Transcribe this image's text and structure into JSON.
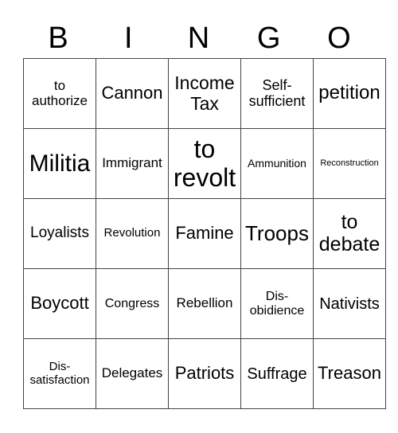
{
  "header": [
    "B",
    "I",
    "N",
    "G",
    "O"
  ],
  "cells": [
    [
      {
        "text": "to authorize",
        "size": 17
      },
      {
        "text": "Cannon",
        "size": 22
      },
      {
        "text": "Income Tax",
        "size": 23
      },
      {
        "text": "Self-sufficient",
        "size": 18
      },
      {
        "text": "petition",
        "size": 24
      }
    ],
    [
      {
        "text": "Militia",
        "size": 30
      },
      {
        "text": "Immigrant",
        "size": 17
      },
      {
        "text": "to revolt",
        "size": 32
      },
      {
        "text": "Ammunition",
        "size": 14
      },
      {
        "text": "Reconstruction",
        "size": 11
      }
    ],
    [
      {
        "text": "Loyalists",
        "size": 19
      },
      {
        "text": "Revolution",
        "size": 15
      },
      {
        "text": "Famine",
        "size": 22
      },
      {
        "text": "Troops",
        "size": 26
      },
      {
        "text": "to debate",
        "size": 25
      }
    ],
    [
      {
        "text": "Boycott",
        "size": 22
      },
      {
        "text": "Congress",
        "size": 16
      },
      {
        "text": "Rebellion",
        "size": 17
      },
      {
        "text": "Dis-obidience",
        "size": 16
      },
      {
        "text": "Nativists",
        "size": 20
      }
    ],
    [
      {
        "text": "Dis-satisfaction",
        "size": 15
      },
      {
        "text": "Delegates",
        "size": 17
      },
      {
        "text": "Patriots",
        "size": 22
      },
      {
        "text": "Suffrage",
        "size": 20
      },
      {
        "text": "Treason",
        "size": 22
      }
    ]
  ]
}
